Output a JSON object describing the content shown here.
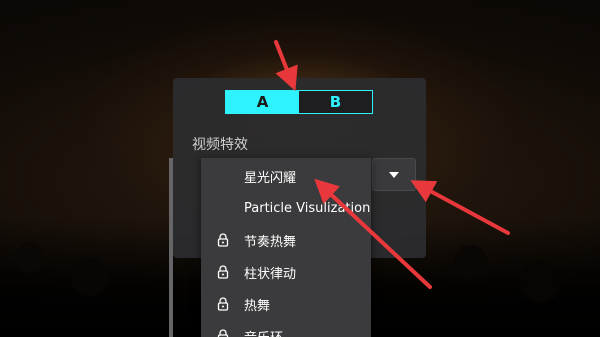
{
  "segmented": {
    "option_a": "A",
    "option_b": "B",
    "selected": "A"
  },
  "section_label": "视频特效",
  "effects_menu": {
    "items": [
      {
        "label": "星光闪耀",
        "locked": false
      },
      {
        "label": "Particle Visulization",
        "locked": false
      },
      {
        "label": "节奏热舞",
        "locked": true
      },
      {
        "label": "柱状律动",
        "locked": true
      },
      {
        "label": "热舞",
        "locked": true
      },
      {
        "label": "音乐环",
        "locked": true
      }
    ]
  },
  "colors": {
    "accent": "#2ff2ff",
    "annotation_arrow": "#e8383b",
    "panel_bg": "#2c2c2e"
  },
  "icons": {
    "dropdown": "chevron-down-icon",
    "lock": "lock-icon"
  }
}
